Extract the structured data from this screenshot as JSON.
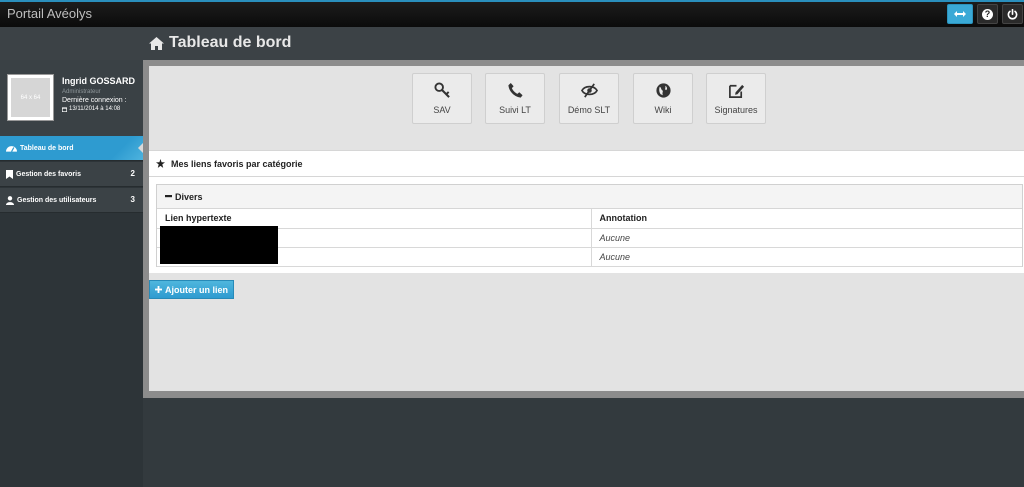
{
  "app": {
    "title": "Portail Avéolys"
  },
  "topbar": {
    "expand_icon": "arrows-horizontal-icon",
    "help_icon": "question-circle-icon",
    "help_glyph": "?",
    "power_icon": "power-icon"
  },
  "page": {
    "title": "Tableau de bord",
    "icon": "home-icon"
  },
  "user": {
    "avatar_text": "64 x 64",
    "name": "Ingrid GOSSARD",
    "role": "Administrateur",
    "last_login_label": "Dernière connexion :",
    "last_login_date": "13/11/2014 à 14:08"
  },
  "sidebar": {
    "items": [
      {
        "label": "Tableau de bord",
        "icon": "dashboard-icon",
        "badge": "",
        "active": true
      },
      {
        "label": "Gestion des favoris",
        "icon": "bookmark-icon",
        "badge": "2",
        "active": false
      },
      {
        "label": "Gestion des utilisateurs",
        "icon": "user-icon",
        "badge": "3",
        "active": false
      }
    ]
  },
  "shortcuts": [
    {
      "label": "SAV",
      "icon": "key-icon"
    },
    {
      "label": "Suivi LT",
      "icon": "phone-icon"
    },
    {
      "label": "Démo SLT",
      "icon": "eye-slash-icon"
    },
    {
      "label": "Wiki",
      "icon": "globe-icon"
    },
    {
      "label": "Signatures",
      "icon": "edit-icon"
    }
  ],
  "favorites": {
    "title": "Mes liens favoris par catégorie",
    "category": {
      "name": "Divers",
      "columns": [
        "Lien hypertexte",
        "Annotation"
      ],
      "rows": [
        {
          "link": "",
          "annotation": "Aucune"
        },
        {
          "link": "",
          "annotation": "Aucune"
        }
      ]
    },
    "add_label": "Ajouter un lien"
  },
  "colors": {
    "accent": "#2e9bd0",
    "topbar_border": "#2a8fbd",
    "sidebar_bg": "#2d3438"
  }
}
